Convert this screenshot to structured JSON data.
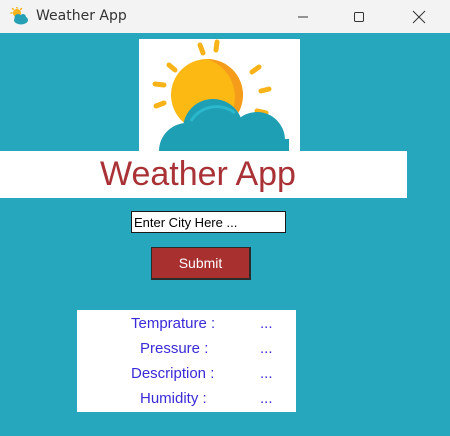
{
  "window": {
    "title": "Weather App",
    "icon": "weather-cloud-sun-icon",
    "controls": [
      "minimize-icon",
      "maximize-icon",
      "close-icon"
    ]
  },
  "logo": {
    "icon": "sun-behind-cloud-icon"
  },
  "banner": {
    "title": "Weather App"
  },
  "search": {
    "value": "Enter City Here ..."
  },
  "submit": {
    "label": "Submit"
  },
  "info": {
    "rows": [
      {
        "label": "Temprature :",
        "value": "..."
      },
      {
        "label": "Pressure :",
        "value": "..."
      },
      {
        "label": "Description :",
        "value": "..."
      },
      {
        "label": "Humidity :",
        "value": "..."
      }
    ]
  },
  "colors": {
    "background": "#27a7bd",
    "title_text": "#a83236",
    "button": "#a8302f",
    "info_text": "#3a2bd8"
  }
}
